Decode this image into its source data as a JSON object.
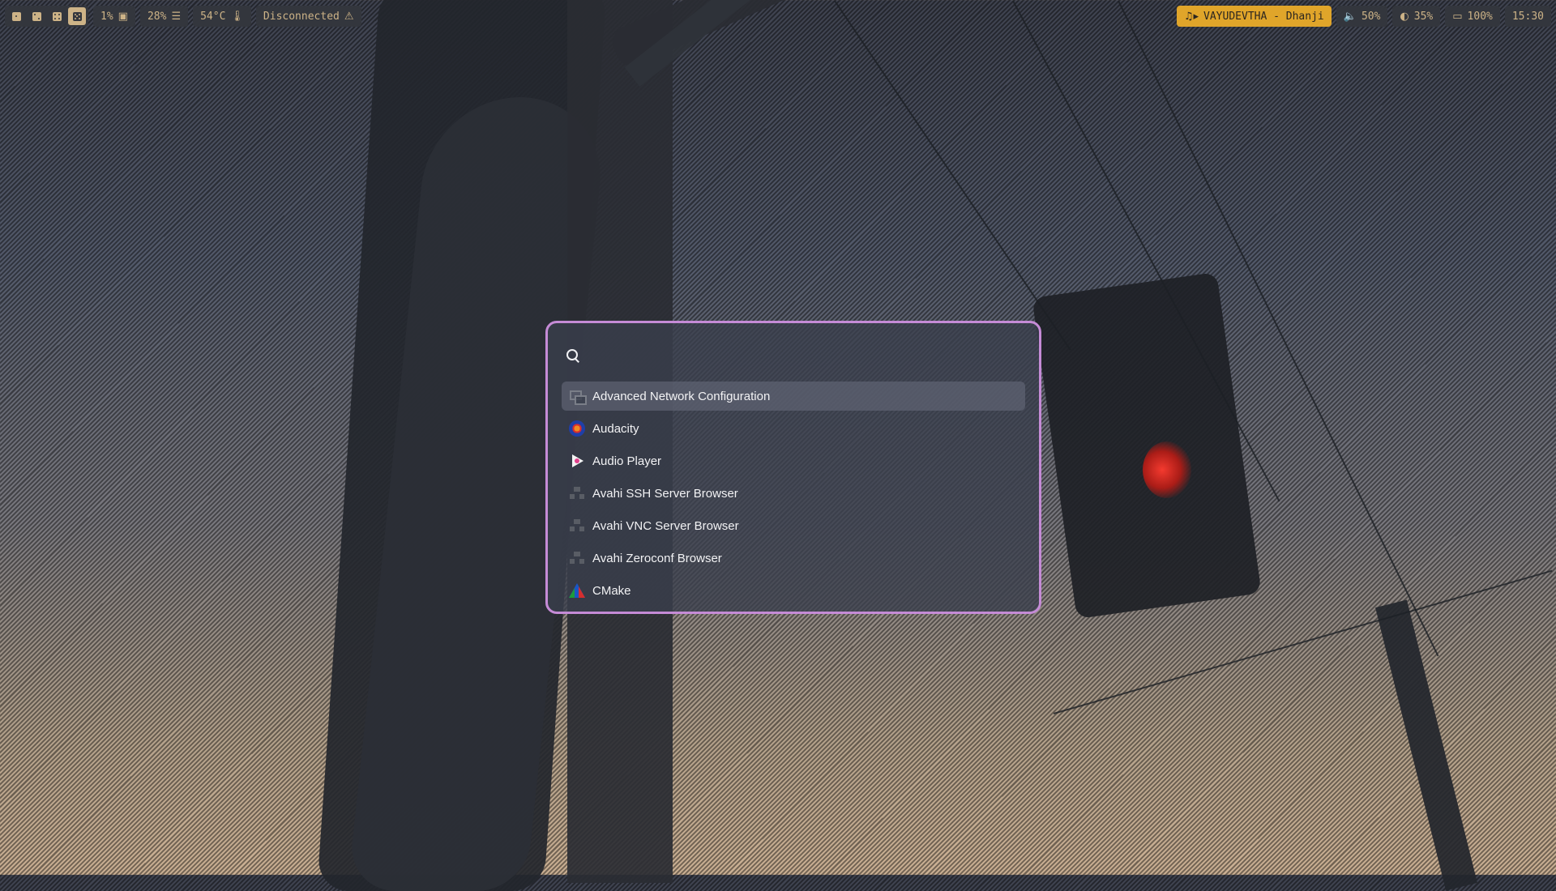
{
  "topbar": {
    "workspaces": [
      "1",
      "2",
      "3",
      "4"
    ],
    "active_workspace": 4,
    "cpu": "1%",
    "memory": "28%",
    "temperature": "54°C",
    "network": "Disconnected",
    "music": "VAYUDEVTHA - Dhanji",
    "volume": "50%",
    "brightness": "35%",
    "battery": "100%",
    "clock": "15:30"
  },
  "launcher": {
    "search_placeholder": "",
    "results": [
      {
        "label": "Advanced Network Configuration",
        "icon": "network-config-icon",
        "selected": true
      },
      {
        "label": "Audacity",
        "icon": "audacity-icon"
      },
      {
        "label": "Audio Player",
        "icon": "audio-player-icon"
      },
      {
        "label": "Avahi SSH Server Browser",
        "icon": "network-icon"
      },
      {
        "label": "Avahi VNC Server Browser",
        "icon": "network-icon"
      },
      {
        "label": "Avahi Zeroconf Browser",
        "icon": "network-icon"
      },
      {
        "label": "CMake",
        "icon": "cmake-icon"
      }
    ],
    "border_color": "#c58bd6"
  },
  "colors": {
    "bar_bg": "#33363d",
    "bar_fg": "#cdb387",
    "music_bg": "#e0a52a"
  }
}
